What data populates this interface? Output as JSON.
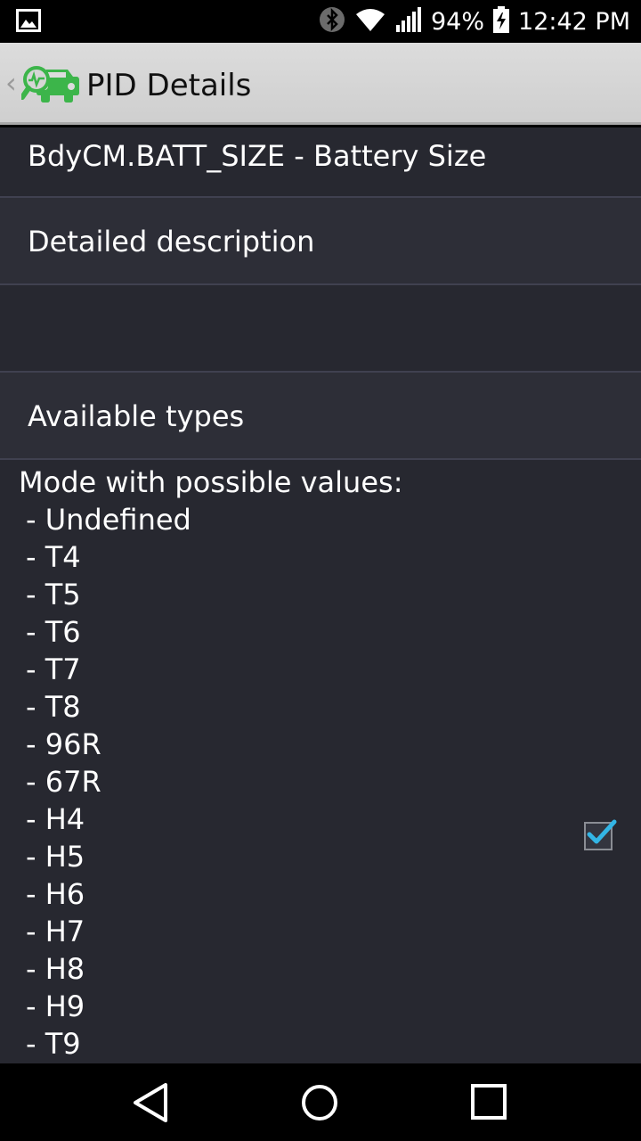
{
  "status_bar": {
    "battery_percent": "94%",
    "time": "12:42 PM",
    "icons": [
      "image-icon",
      "bluetooth-icon",
      "wifi-icon",
      "signal-icon",
      "battery-charging-icon"
    ]
  },
  "action_bar": {
    "title": "PID Details",
    "icon": "car-diagnostic-icon"
  },
  "pid": {
    "name": "BdyCM.BATT_SIZE - Battery Size"
  },
  "sections": {
    "description_header": "Detailed description",
    "description_body": "",
    "types_header": "Available types"
  },
  "types": {
    "intro": "Mode with possible values:",
    "values": [
      "- Undefined",
      "- T4",
      "- T5",
      "- T6",
      "- T7",
      "- T8",
      "- 96R",
      "- 67R",
      "- H4",
      "- H5",
      "- H6",
      "- H7",
      "- H8",
      "- H9",
      "- T9"
    ]
  },
  "checkbox": {
    "checked": true
  },
  "nav_bar": {
    "icons": [
      "back-icon",
      "home-icon",
      "recents-icon"
    ]
  },
  "colors": {
    "content_bg": "#272830",
    "header_bg": "#2d2e37",
    "accent": "#33b5e5",
    "app_icon_green": "#3cb54a"
  }
}
